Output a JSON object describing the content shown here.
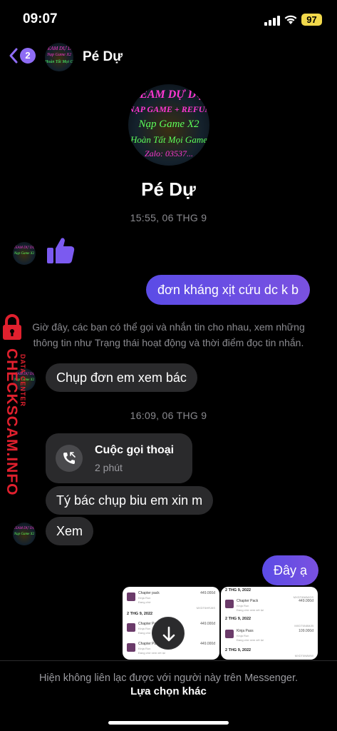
{
  "status_bar": {
    "time": "09:07",
    "battery": "97"
  },
  "header": {
    "back_count": "2",
    "contact_name": "Pé Dự"
  },
  "avatar_text": {
    "line1": "TEAM DỰ DỰ",
    "line2": "NẠP GAME + REFUND",
    "line3": "Nạp Game X2",
    "line4": "Hoàn Tất Mọi Game",
    "line5": "Zalo: 03537..."
  },
  "profile": {
    "name": "Pé Dự"
  },
  "messages": {
    "timestamp1": "15:55, 06 THG 9",
    "outgoing1": "đơn kháng xịt cứu dc k b",
    "notice_line1": "Giờ đây, các bạn có thể gọi và nhắn tin cho nhau, xem những",
    "notice_line2": "thông tin như Trạng thái hoạt động và thời điểm đọc tin nhắn.",
    "incoming1": "Chụp đơn em xem bác",
    "timestamp2": "16:09, 06 THG 9",
    "call_title": "Cuộc gọi thoại",
    "call_duration": "2 phút",
    "incoming2": "Tý bác chụp biu em xin m",
    "incoming3": "Xem",
    "outgoing2": "Đây ạ"
  },
  "screenshot_left": {
    "r1_name": "Chapter pack",
    "r1_amount": "449.000đ",
    "r1_sub1": "Kinja Run",
    "r1_sub2": "Đang chờ",
    "r1_id": "MXDT6HRJ8S",
    "date": "2 THG 9, 2022",
    "r2_name": "Chapter Pack",
    "r2_amount": "449.000đ",
    "r2_sub1": "Kinja Run",
    "r2_sub2": "Đang chờ xem xét lại",
    "r3_name": "Chapter Pack",
    "r3_amount": "449.000đ",
    "r3_sub1": "Kinja Run",
    "r3_sub2": "Đang chờ xem xét lại"
  },
  "screenshot_right": {
    "date1": "2 THG 9, 2022",
    "id1": "MXDT6N8WGS",
    "r1_name": "Chapter Pack",
    "r1_amount": "449.000đ",
    "r1_sub1": "Kinja Run",
    "r1_sub2": "Đang chờ xem xét lại",
    "date2": "2 THG 9, 2022",
    "id2": "MXDT6N8MJB",
    "r2_name": "Kinja Pass",
    "r2_amount": "109.000đ",
    "r2_sub1": "Kinja Run",
    "r2_sub2": "Đang chờ xem xét lại",
    "date3": "2 THG 9, 2022",
    "id3": "MXDT6N8WW"
  },
  "footer": {
    "message": "Hiện không liên lạc được với người này trên Messenger.",
    "option": "Lựa chọn khác"
  },
  "watermark": {
    "main": "CHECKSCAM.INFO",
    "sub": "DATA CENTER"
  },
  "colors": {
    "accent": "#8e6cf5",
    "outgoing_bubble": "#6d4fe0",
    "incoming_bubble": "#2a2a2c",
    "watermark": "#e0202e"
  }
}
